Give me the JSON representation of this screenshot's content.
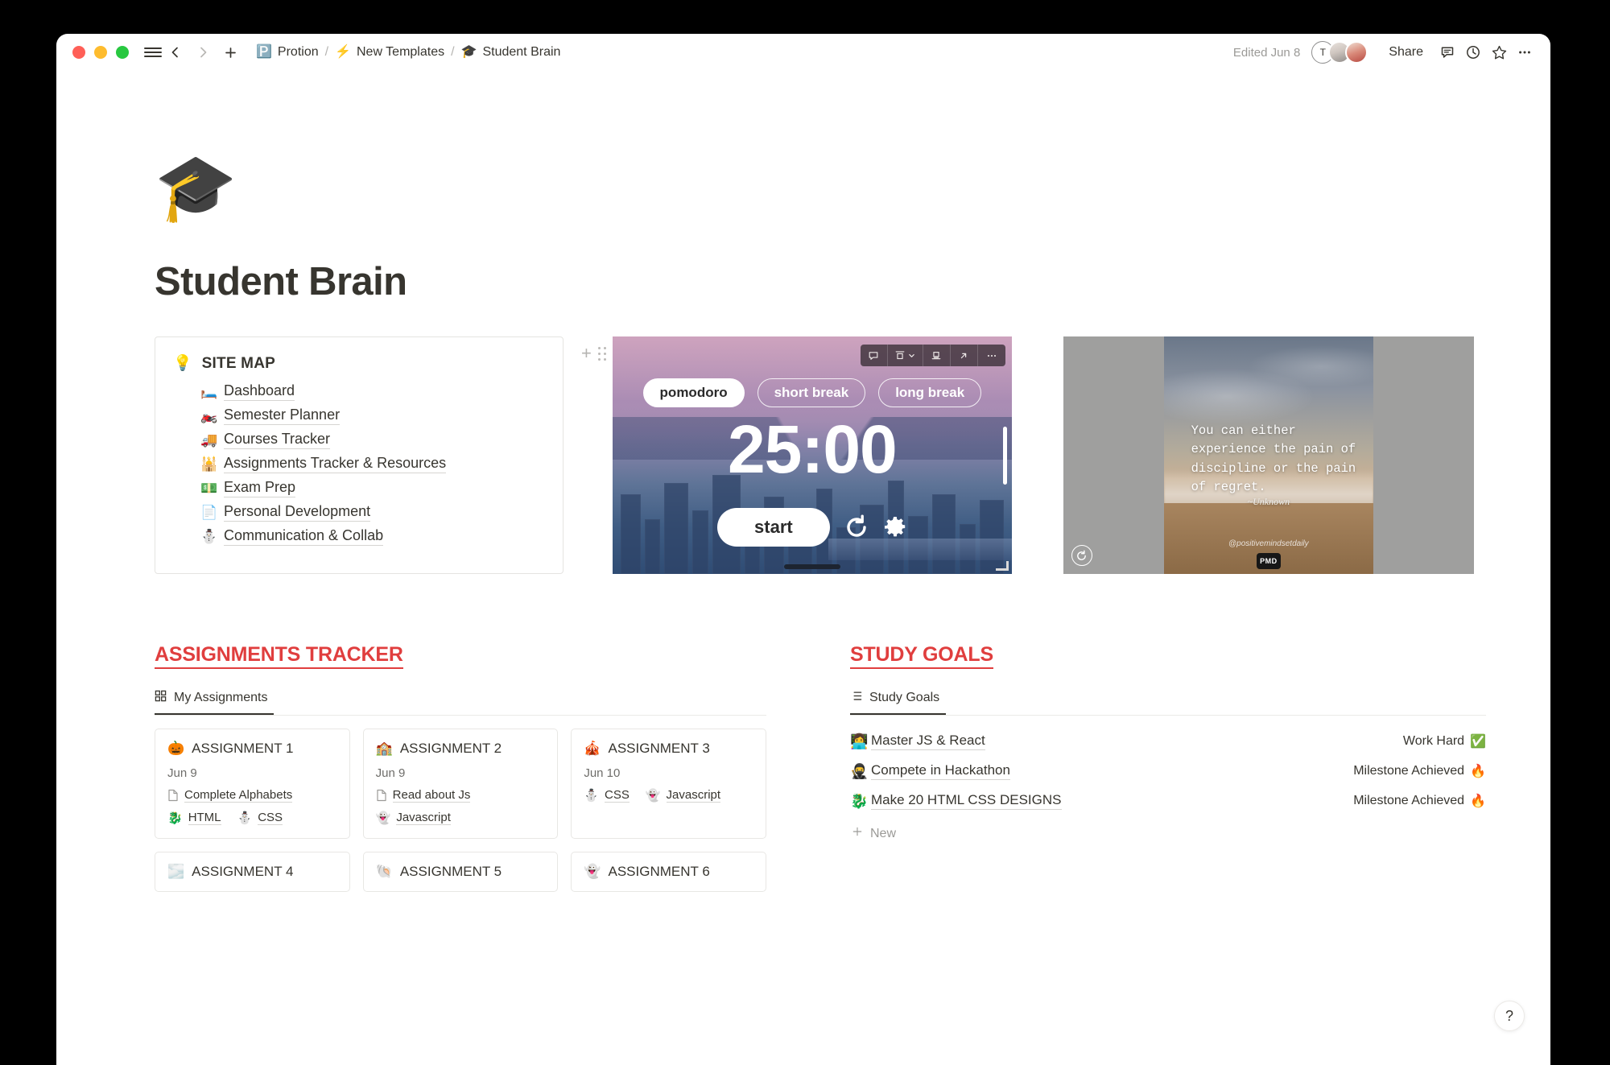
{
  "titlebar": {
    "breadcrumb": [
      {
        "emoji": "🅿️",
        "label": "Protion",
        "icon_name": "protion-workspace-icon"
      },
      {
        "emoji": "⚡",
        "label": "New Templates",
        "icon_name": "lightning-icon"
      },
      {
        "emoji": "🎓",
        "label": "Student Brain",
        "icon_name": "graduation-icon"
      }
    ],
    "separator": "/",
    "edited": "Edited Jun 8",
    "avatar_initial": "T",
    "share_label": "Share",
    "icons": {
      "menu": "hamburger-icon",
      "back": "chevron-left-icon",
      "forward": "chevron-right-icon",
      "new": "plus-icon",
      "comment": "comment-icon",
      "history": "clock-icon",
      "favorite": "star-icon",
      "more": "more-options-icon"
    }
  },
  "page": {
    "icon": "🎓",
    "title": "Student Brain"
  },
  "sitemap": {
    "bulb": "💡",
    "heading": "SITE MAP",
    "items": [
      {
        "emoji": "🛏️",
        "label": "Dashboard"
      },
      {
        "emoji": "🏍️",
        "label": "Semester Planner"
      },
      {
        "emoji": "🚚",
        "label": "Courses Tracker"
      },
      {
        "emoji": "🕌",
        "label": "Assignments Tracker & Resources"
      },
      {
        "emoji": "💵",
        "label": "Exam Prep"
      },
      {
        "emoji": "📄",
        "label": "Personal Development"
      },
      {
        "emoji": "⛄",
        "label": "Communication & Collab"
      }
    ]
  },
  "pomodoro": {
    "tabs": [
      {
        "label": "pomodoro",
        "active": true
      },
      {
        "label": "short break",
        "active": false
      },
      {
        "label": "long break",
        "active": false
      }
    ],
    "time": "25:00",
    "start_label": "start",
    "toolbar": [
      "comment-icon",
      "align-top-icon",
      "chevron-down-icon",
      "align-bottom-icon",
      "expand-icon",
      "more-options-icon"
    ]
  },
  "quote": {
    "text": "You can either experience the pain of discipline or the pain of regret.",
    "author": "~Unknown",
    "handle": "@positivemindsetdaily",
    "badge": "PMD"
  },
  "assignments": {
    "title": "ASSIGNMENTS TRACKER",
    "tab_label": "My Assignments",
    "tab_icon": "gallery-view-icon",
    "cards": [
      {
        "emoji": "🎃",
        "title": "ASSIGNMENT 1",
        "date": "Jun 9",
        "doc": "Complete Alphabets",
        "tags": [
          {
            "emoji": "🐉",
            "label": "HTML"
          },
          {
            "emoji": "⛄",
            "label": "CSS"
          }
        ]
      },
      {
        "emoji": "🏫",
        "title": "ASSIGNMENT 2",
        "date": "Jun 9",
        "doc": "Read about Js",
        "tags": [
          {
            "emoji": "👻",
            "label": "Javascript"
          }
        ]
      },
      {
        "emoji": "🎪",
        "title": "ASSIGNMENT 3",
        "date": "Jun 10",
        "doc": "",
        "tags": [
          {
            "emoji": "⛄",
            "label": "CSS"
          },
          {
            "emoji": "👻",
            "label": "Javascript"
          }
        ]
      },
      {
        "emoji": "🌫️",
        "title": "ASSIGNMENT 4",
        "date": "",
        "doc": "",
        "tags": []
      },
      {
        "emoji": "🐚",
        "title": "ASSIGNMENT 5",
        "date": "",
        "doc": "",
        "tags": []
      },
      {
        "emoji": "👻",
        "title": "ASSIGNMENT 6",
        "date": "",
        "doc": "",
        "tags": []
      }
    ]
  },
  "study_goals": {
    "title": "STUDY GOALS",
    "tab_label": "Study Goals",
    "tab_icon": "list-view-icon",
    "new_label": "New",
    "items": [
      {
        "emoji": "👩‍💻",
        "name": "Master JS & React",
        "status": "Work Hard",
        "status_emoji": "✅"
      },
      {
        "emoji": "🥷",
        "name": "Compete in Hackathon",
        "status": "Milestone Achieved",
        "status_emoji": "🔥"
      },
      {
        "emoji": "🐉",
        "name": "Make 20 HTML CSS DESIGNS",
        "status": "Milestone Achieved",
        "status_emoji": "🔥"
      }
    ]
  },
  "help": {
    "label": "?"
  },
  "colors": {
    "accent_red": "#e03e3e",
    "text": "#37352f",
    "muted": "#9b9a97"
  }
}
